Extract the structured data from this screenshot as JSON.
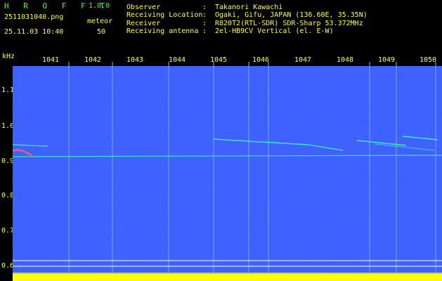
{
  "header": {
    "app_title": "H R O F F T",
    "version": "1.0.0",
    "filename": "2511031040.png",
    "timestamp": "25.11.03 10:40",
    "meteor_label": "meteor",
    "meteor_count": "50"
  },
  "info": [
    {
      "key": "Observer",
      "colon": ":",
      "value": "Takanori Kawachi"
    },
    {
      "key": "Receiving Location",
      "colon": ":",
      "value": "Ogaki, Gifu, JAPAN (136.60E, 35.35N)"
    },
    {
      "key": "Receiver",
      "colon": ":",
      "value": "R820T2(RTL-SDR) SDR-Sharp 53.372MHz"
    },
    {
      "key": "Receiving antenna",
      "colon": ":",
      "value": "2el-HB9CV Vertical (el. E-W)"
    }
  ],
  "spectrogram": {
    "unit_label": "kHz",
    "y_ticks": [
      "1.1",
      "1.0",
      "0.9",
      "0.8",
      "0.7",
      "0.6"
    ],
    "x_ticks": [
      "1041",
      "1042",
      "1043",
      "1044",
      "1045",
      "1046",
      "1047",
      "1048",
      "1049",
      "1050"
    ],
    "colors": {
      "background": "#000000",
      "noise": "#0a1aa8",
      "signal": "#38f0c0",
      "text": "#ffff40",
      "title": "#3cff3c",
      "meter": "#ffff00"
    }
  }
}
